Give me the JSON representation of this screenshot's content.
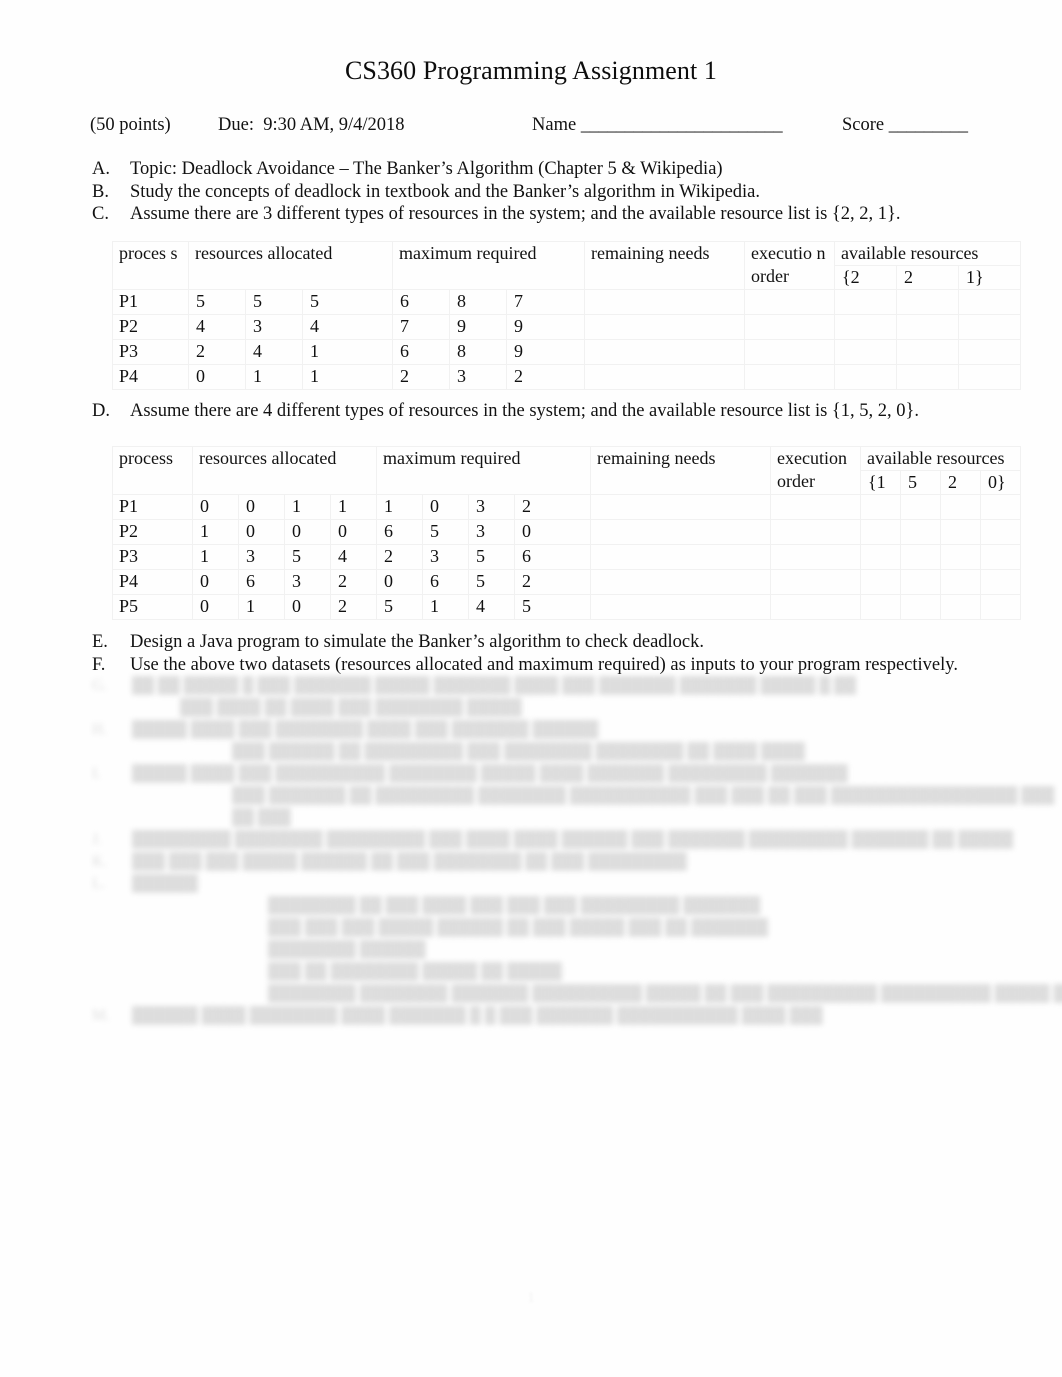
{
  "document": {
    "title": "CS360 Programming Assignment 1",
    "page_number": "1"
  },
  "info": {
    "points": "(50 points)",
    "due": "Due:  9:30 AM, 9/4/2018",
    "name_label": "Name",
    "name_rule": "_______________________",
    "score_label": "Score",
    "score_rule": "_________"
  },
  "outline": {
    "a": {
      "marker": "A.",
      "text": "Topic: Deadlock Avoidance – The Banker’s Algorithm (Chapter 5 & Wikipedia)"
    },
    "b": {
      "marker": "B.",
      "text": "Study the concepts of deadlock in textbook and the Banker’s algorithm in Wikipedia."
    },
    "c": {
      "marker": "C.",
      "text": "Assume there are 3 different types of resources in the system; and the available resource list is {2, 2, 1}."
    },
    "d": {
      "marker": "D.",
      "text": "Assume there are 4 different types of resources in the system; and the available resource list is {1, 5, 2, 0}."
    },
    "e": {
      "marker": "E.",
      "text": "Design a Java program to simulate the Banker’s algorithm to check deadlock."
    },
    "f": {
      "marker": "F.",
      "text": "Use the above two datasets (resources allocated and maximum required) as inputs to your program respectively."
    }
  },
  "table1": {
    "headers": {
      "process": "proces s",
      "allocated": "resources allocated",
      "maximum": "maximum required",
      "remaining": "remaining needs",
      "execution": "executio n order",
      "available": "available resources",
      "avail_v1": "{2",
      "avail_v2": "2",
      "avail_v3": "1}"
    },
    "rows": [
      {
        "process": "P1",
        "allocated": [
          "5",
          "5",
          "5"
        ],
        "maximum": [
          "6",
          "8",
          "7"
        ]
      },
      {
        "process": "P2",
        "allocated": [
          "4",
          "3",
          "4"
        ],
        "maximum": [
          "7",
          "9",
          "9"
        ]
      },
      {
        "process": "P3",
        "allocated": [
          "2",
          "4",
          "1"
        ],
        "maximum": [
          "6",
          "8",
          "9"
        ]
      },
      {
        "process": "P4",
        "allocated": [
          "0",
          "1",
          "1"
        ],
        "maximum": [
          "2",
          "3",
          "2"
        ]
      }
    ]
  },
  "table2": {
    "headers": {
      "process": "process",
      "allocated": "resources allocated",
      "maximum": "maximum required",
      "remaining": "remaining needs",
      "execution": "execution order",
      "available": "available resources",
      "avail_v1": "{1",
      "avail_v2": "5",
      "avail_v3": "2",
      "avail_v4": "0}"
    },
    "rows": [
      {
        "process": "P1",
        "allocated": [
          "0",
          "0",
          "1",
          "1"
        ],
        "maximum": [
          "1",
          "0",
          "3",
          "2"
        ]
      },
      {
        "process": "P2",
        "allocated": [
          "1",
          "0",
          "0",
          "0"
        ],
        "maximum": [
          "6",
          "5",
          "3",
          "0"
        ]
      },
      {
        "process": "P3",
        "allocated": [
          "1",
          "3",
          "5",
          "4"
        ],
        "maximum": [
          "2",
          "3",
          "5",
          "6"
        ]
      },
      {
        "process": "P4",
        "allocated": [
          "0",
          "6",
          "3",
          "2"
        ],
        "maximum": [
          "0",
          "6",
          "5",
          "2"
        ]
      },
      {
        "process": "P5",
        "allocated": [
          "0",
          "1",
          "0",
          "2"
        ],
        "maximum": [
          "5",
          "1",
          "4",
          "5"
        ]
      }
    ]
  },
  "redacted": {
    "note": "illegible blurred text",
    "lines": [
      {
        "marker": "G.",
        "indent": 0,
        "text": "██ ██ █████ █ ███ ███████ █████   ███████ ████   ███  ███████ ███████  █████ █ ██"
      },
      {
        "marker": "",
        "indent": 1,
        "text": "███ ████ ██ ████ ███ ████████ █████"
      },
      {
        "marker": "H.",
        "indent": 0,
        "text": "█████ ████ ███ ████████ ████ ███ ███████ ██████"
      },
      {
        "marker": "",
        "indent": 2,
        "text": "███ ██████ ██ █████████  ███ ████████ ████████ ██ ████ ████"
      },
      {
        "marker": "I.",
        "indent": 0,
        "text": "█████ ████ ███ ██████████  ████████ █████   ████  ███████ █████████ ███████"
      },
      {
        "marker": "",
        "indent": 2,
        "text": "███ ███████ ██ █████████  ████████ ███████████ ███ ███ ██ ███  █████████████████ ███"
      },
      {
        "marker": "",
        "indent": 2,
        "text": "██ ███"
      },
      {
        "marker": "J.",
        "indent": 0,
        "text": "█████████ ████████ █████████ ███ ████ ████  ██████ ███ ███████ █████████ ███████ ██ █████"
      },
      {
        "marker": "K.",
        "indent": 0,
        "text": "███ ███ ███ █████ ██████ ██ ███ ████████ ██ ███ █████████"
      },
      {
        "marker": "L.",
        "indent": 0,
        "text": "██████"
      },
      {
        "marker": "",
        "indent": 3,
        "text": "████████ ██ ███ ████ ███ ███ ███ █████████ ███████"
      },
      {
        "marker": "",
        "indent": 3,
        "text": "███ ███ ███ █████ ██████ ██ ███ █████ ███ ██ ███████"
      },
      {
        "marker": "",
        "indent": 3,
        "text": "████████ ██████"
      },
      {
        "marker": "",
        "indent": 3,
        "text": "███ ██ ████████ █████ ██ █████"
      },
      {
        "marker": "",
        "indent": 3,
        "text": "████████ ████████ ███████ ██████████ █████  ██ ███ ██████████  ██████████ █████ ███ ███ ███████████ ████████"
      },
      {
        "marker": "M.",
        "indent": 0,
        "text": "██████ ████ ████████ ████ ███████ █ █ ███ ███████ ███████████ ████ ███"
      }
    ]
  }
}
